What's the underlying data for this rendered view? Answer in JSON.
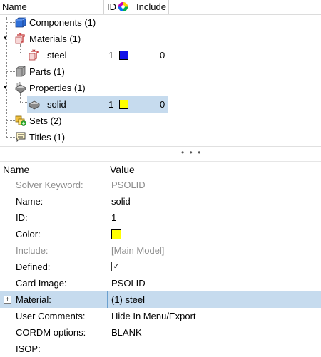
{
  "tree_header": {
    "name": "Name",
    "id": "ID",
    "include": "Include",
    "color_icon": "color-wheel-icon"
  },
  "tree": {
    "components": {
      "label": "Components (1)",
      "icon": "components-icon"
    },
    "materials": {
      "label": "Materials (1)",
      "icon": "materials-icon"
    },
    "steel": {
      "label": "steel",
      "id": "1",
      "color": "#1010e8",
      "include": "0",
      "icon": "material-icon"
    },
    "parts": {
      "label": "Parts (1)",
      "icon": "parts-icon"
    },
    "properties": {
      "label": "Properties (1)",
      "icon": "properties-icon"
    },
    "solid": {
      "label": "solid",
      "id": "1",
      "color": "#ffff00",
      "include": "0",
      "icon": "property-icon"
    },
    "sets": {
      "label": "Sets (2)",
      "icon": "sets-icon"
    },
    "titles": {
      "label": "Titles (1)",
      "icon": "titles-icon"
    }
  },
  "splitter": {
    "handle": "• • •"
  },
  "prop_header": {
    "name": "Name",
    "value": "Value"
  },
  "props": [
    {
      "name": "Solver Keyword:",
      "value": "PSOLID"
    },
    {
      "name": "Name:",
      "value": "solid"
    },
    {
      "name": "ID:",
      "value": "1"
    },
    {
      "name": "Color:",
      "color": "#ffff00"
    },
    {
      "name": "Include:",
      "value": "[Main Model]"
    },
    {
      "name": "Defined:",
      "checked": "✓"
    },
    {
      "name": "Card Image:",
      "value": "PSOLID"
    },
    {
      "name": "Material:",
      "value": "(1) steel"
    },
    {
      "name": "User Comments:",
      "value": "Hide In Menu/Export"
    },
    {
      "name": "CORDM options:",
      "value": "BLANK"
    },
    {
      "name": "ISOP:",
      "value": ""
    }
  ]
}
